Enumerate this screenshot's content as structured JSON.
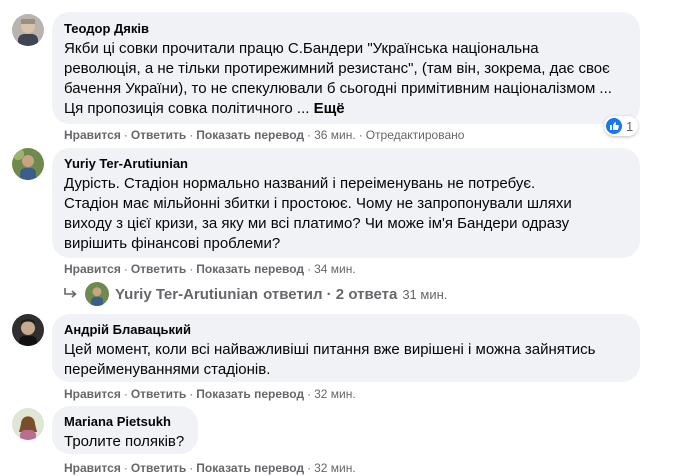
{
  "actions": {
    "like": "Нравится",
    "reply": "Ответить",
    "translate": "Показать перевод",
    "separator": "·"
  },
  "comments": [
    {
      "author": "Теодор Дяків",
      "text": "Якби ці совки прочитали працю С.Бандери \"Українська національна\nреволюція, а не тільки протирежимний резистанс\", (там він, зокрема, дає своє\nбачення України), то не спекулювали б сьогодні примітивним націоналізмом ...\nЦя пропозиція совка політичного ... ",
      "more": "Ещё",
      "time": "36 мин.",
      "edited": "Отредактировано",
      "reaction_count": "1"
    },
    {
      "author": "Yuriy Ter-Arutiunian",
      "text": "Дурість. Стадіон нормально названий і переіменувань не потребує.\nСтадіон має мільйонні збитки і простоює. Чому не запропонували шляхи\nвиходу з цієї кризи, за яку ми всі платимо? Чи може ім'я Бандери одразу\nвирішить фінансові проблеми?",
      "time": "34 мин."
    },
    {
      "author": "Андрій Блавацький",
      "text": "Цей момент, коли всі найважливіші питання вже вирішені і можна зайнятись\nперейменуваннями стадіонів.",
      "time": "32 мин."
    },
    {
      "author": "Mariana Pietsukh",
      "text": "Тролите поляків?",
      "time": "32 мин."
    }
  ],
  "replies_row": {
    "author": "Yuriy Ter-Arutiunian",
    "text": "ответил · 2 ответа",
    "time": "31 мин."
  },
  "colors": {
    "bubble": "#f0f2f5",
    "meta": "#65676b",
    "like": "#1877f2"
  },
  "icons": [
    "reply-arrow-icon",
    "like-icon"
  ]
}
